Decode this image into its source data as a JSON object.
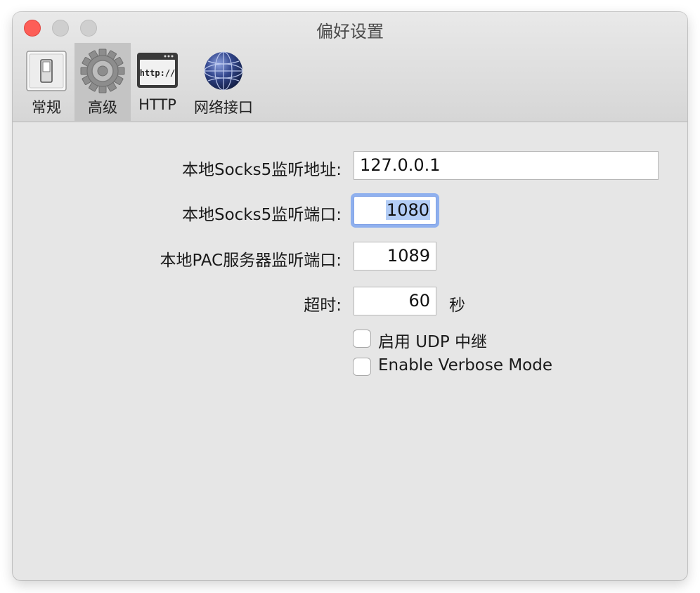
{
  "window": {
    "title": "偏好设置"
  },
  "toolbar": {
    "items": [
      {
        "label": "常规",
        "icon": "switch-icon",
        "selected": false
      },
      {
        "label": "高级",
        "icon": "gear-icon",
        "selected": true
      },
      {
        "label": "HTTP",
        "icon": "http-window-icon",
        "selected": false
      },
      {
        "label": "网络接口",
        "icon": "globe-icon",
        "selected": false
      }
    ]
  },
  "form": {
    "socks_address": {
      "label": "本地Socks5监听地址:",
      "value": "127.0.0.1"
    },
    "socks_port": {
      "label": "本地Socks5监听端口:",
      "value": "1080"
    },
    "pac_port": {
      "label": "本地PAC服务器监听端口:",
      "value": "1089"
    },
    "timeout": {
      "label": "超时:",
      "value": "60",
      "unit": "秒"
    },
    "udp_relay": {
      "label": "启用 UDP 中继",
      "checked": false
    },
    "verbose_mode": {
      "label": "Enable Verbose Mode",
      "checked": false
    }
  },
  "colors": {
    "close_button": "#fd5e57",
    "focus_ring": "#8fb0ee",
    "selection": "#b3cdf6"
  }
}
